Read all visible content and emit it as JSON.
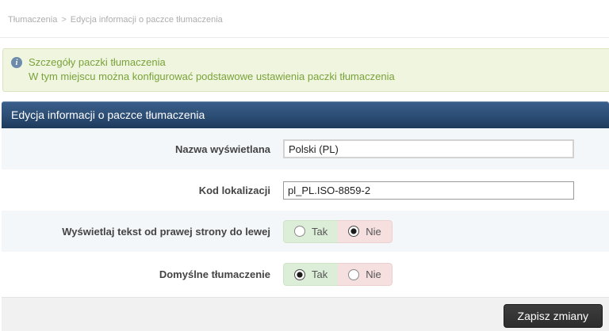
{
  "breadcrumb": {
    "items": [
      "Tłumaczenia",
      "Edycja informacji o paczce tłumaczenia"
    ],
    "separator": ">"
  },
  "info_box": {
    "icon": "info-icon",
    "icon_glyph": "i",
    "title": "Szczegóły paczki tłumaczenia",
    "description": "W tym miejscu można konfigurować podstawowe ustawienia paczki tłumaczenia"
  },
  "panel": {
    "title": "Edycja informacji o paczce tłumaczenia"
  },
  "form": {
    "fields": [
      {
        "label": "Nazwa wyświetlana",
        "type": "text",
        "value": "Polski (PL)"
      },
      {
        "label": "Kod lokalizacji",
        "type": "text",
        "value": "pl_PL.ISO-8859-2"
      },
      {
        "label": "Wyświetlaj tekst od prawej strony do lewej",
        "type": "radio",
        "options": [
          {
            "label": "Tak",
            "selected": false
          },
          {
            "label": "Nie",
            "selected": true
          }
        ]
      },
      {
        "label": "Domyślne tłumaczenie",
        "type": "radio",
        "options": [
          {
            "label": "Tak",
            "selected": true
          },
          {
            "label": "Nie",
            "selected": false
          }
        ]
      }
    ]
  },
  "footer": {
    "save_button": "Zapisz zmiany"
  },
  "colors": {
    "info_text": "#7aa23a",
    "info_bg": "#eff5df",
    "header_gradient_top": "#3a608c",
    "header_gradient_bottom": "#1d3a5c",
    "row_alt_bg": "#f4f7fa",
    "radio_yes_bg": "#ddeed8",
    "radio_no_bg": "#f5dfdf",
    "button_bg": "#2d2d2d",
    "breadcrumb_text": "#aeaeae"
  }
}
